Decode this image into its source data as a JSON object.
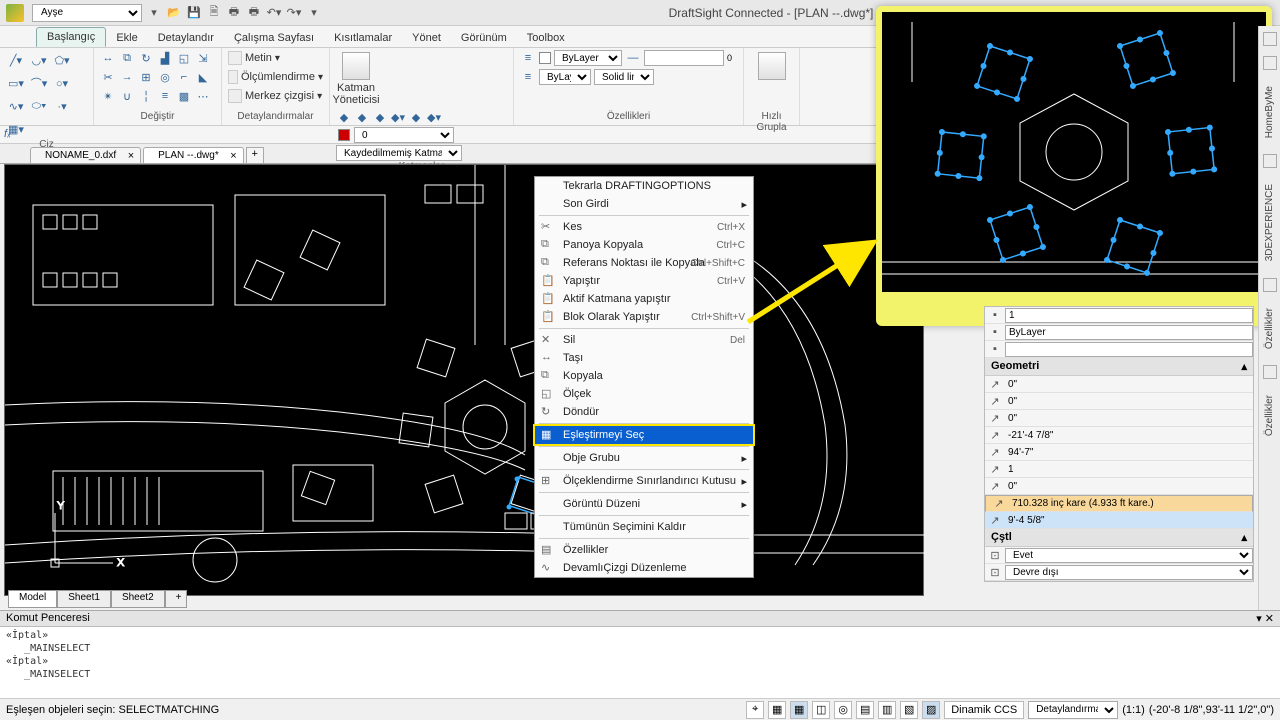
{
  "title": "DraftSight Connected - [PLAN --.dwg*]",
  "workspace": "Ayşe",
  "ribbon_tabs": [
    "Başlangıç",
    "Ekle",
    "Detaylandır",
    "Çalışma Sayfası",
    "Kısıtlamalar",
    "Yönet",
    "Görünüm",
    "Toolbox"
  ],
  "ribbon_active": 0,
  "ribbon_groups": {
    "ciz": "Çiz",
    "degistir": "Değiştir",
    "detay": "Detaylandırmalar",
    "katmanlar": "Katmanlar",
    "ozellik": "Özellikleri",
    "hizli": "Hızlı Grupla"
  },
  "detay_items": [
    "Metin",
    "Ölçümlendirme",
    "Merkez çizgisi"
  ],
  "katman_big": "Katman Yöneticisi",
  "katman_sel": "Kaydedilmemiş Katman Du",
  "ozellik_sel1": "ByLayer",
  "ozellik_sel2": "ByLayer",
  "ozellik_sel3": "Solid line",
  "doc_tabs": [
    {
      "name": "NONAME_0.dxf",
      "active": false
    },
    {
      "name": "PLAN --.dwg*",
      "active": true
    }
  ],
  "context_menu": [
    {
      "label": "Tekrarla DRAFTINGOPTIONS"
    },
    {
      "label": "Son Girdi",
      "arrow": true
    },
    {
      "sep": true
    },
    {
      "label": "Kes",
      "icon": "✂",
      "shortcut": "Ctrl+X"
    },
    {
      "label": "Panoya Kopyala",
      "icon": "⧉",
      "shortcut": "Ctrl+C"
    },
    {
      "label": "Referans Noktası ile Kopyala",
      "icon": "⧉",
      "shortcut": "Ctrl+Shift+C"
    },
    {
      "label": "Yapıştır",
      "icon": "📋",
      "shortcut": "Ctrl+V"
    },
    {
      "label": "Aktif Katmana yapıştır",
      "icon": "📋"
    },
    {
      "label": "Blok Olarak Yapıştır",
      "icon": "📋",
      "shortcut": "Ctrl+Shift+V"
    },
    {
      "sep": true
    },
    {
      "label": "Sil",
      "icon": "✕",
      "shortcut": "Del"
    },
    {
      "label": "Taşı",
      "icon": "↔"
    },
    {
      "label": "Kopyala",
      "icon": "⧉"
    },
    {
      "label": "Ölçek",
      "icon": "◱"
    },
    {
      "label": "Döndür",
      "icon": "↻"
    },
    {
      "sep": true
    },
    {
      "label": "Eşleştirmeyi Seç",
      "icon": "▦",
      "hl": true
    },
    {
      "sep": true
    },
    {
      "label": "Obje Grubu",
      "arrow": true
    },
    {
      "sep": true
    },
    {
      "label": "Ölçeklendirme Sınırlandırıcı Kutusu",
      "icon": "⊞",
      "arrow": true
    },
    {
      "sep": true
    },
    {
      "label": "Görüntü Düzeni",
      "arrow": true
    },
    {
      "sep": true
    },
    {
      "label": "Tümünün Seçimini Kaldır"
    },
    {
      "sep": true
    },
    {
      "label": "Özellikler",
      "icon": "▤"
    },
    {
      "label": "DevamlıÇizgi Düzenleme",
      "icon": "∿"
    }
  ],
  "properties": {
    "topvals": [
      "1",
      "ByLayer",
      ""
    ],
    "geo_header": "Geometri",
    "geo_rows": [
      {
        "v": "0\""
      },
      {
        "v": "0\""
      },
      {
        "v": "0\""
      },
      {
        "v": "-21'-4 7/8\""
      },
      {
        "v": "94'-7\""
      },
      {
        "v": "1"
      },
      {
        "v": "0\""
      },
      {
        "v": "710.328 inç kare (4.933 ft kare.)",
        "sel": true
      },
      {
        "v": "9'-4 5/8\"",
        "hl": true
      }
    ],
    "cst_header": "Çştl",
    "cst_rows": [
      {
        "v": "Evet",
        "sel": true
      },
      {
        "v": "Devre dışı",
        "sel": true
      }
    ]
  },
  "sidebar_tabs": [
    "HomeByMe",
    "3DEXPERIENCE",
    "Özellikler",
    "Özellikler"
  ],
  "sheets": [
    "Model",
    "Sheet1",
    "Sheet2"
  ],
  "cmd_header": "Komut Penceresi",
  "cmd_log": "«İptal»\n   _MAINSELECT\n«İptal»\n   _MAINSELECT",
  "status_left": "Eşleşen objeleri seçin: SELECTMATCHING",
  "status_dinamik": "Dinamik CCS",
  "status_detay": "Detaylandırma",
  "status_ratio": "(1:1)",
  "status_coord": "(-20'-8 1/8\",93'-11 1/2\",0\")"
}
